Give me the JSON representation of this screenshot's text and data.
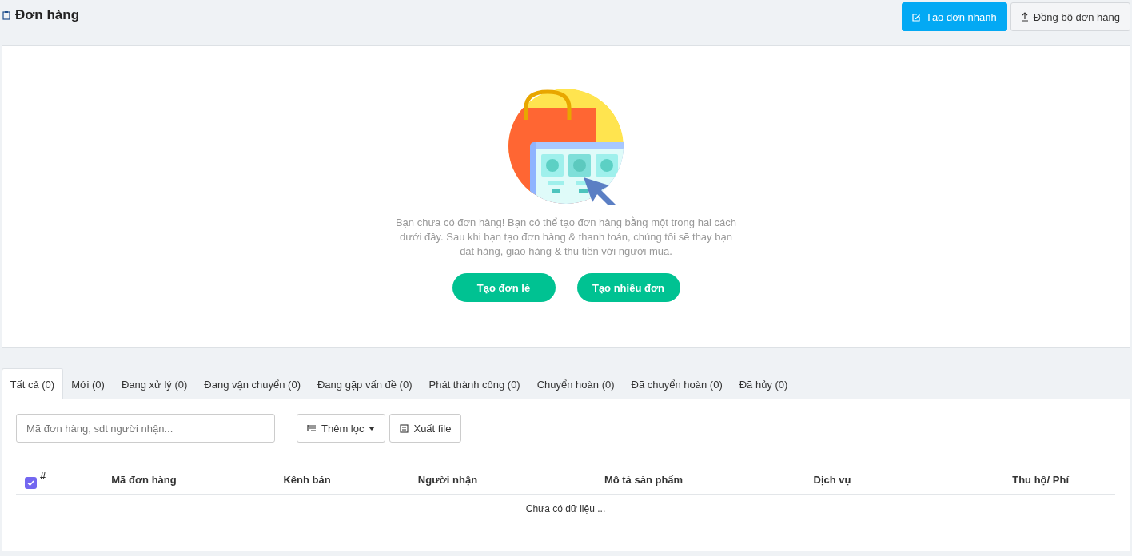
{
  "header": {
    "title": "Đơn hàng",
    "buttons": [
      {
        "label": "Tạo đơn nhanh",
        "kind": "primary"
      },
      {
        "label": "Đồng bộ đơn hàng",
        "kind": "default"
      }
    ]
  },
  "empty_state": {
    "message": "Bạn chưa có đơn hàng! Bạn có thể tạo đơn hàng bằng một trong hai cách dưới đây. Sau khi bạn tạo đơn hàng & thanh toán, chúng tôi sẽ thay bạn đặt hàng, giao hàng & thu tiền với người mua.",
    "buttons": [
      "Tạo đơn lẻ",
      "Tạo nhiều đơn"
    ]
  },
  "tabs": [
    {
      "label": "Tất cả (0)",
      "selected": true
    },
    {
      "label": "Mới (0)",
      "selected": false
    },
    {
      "label": "Đang xử lý (0)",
      "selected": false
    },
    {
      "label": "Đang vận chuyển (0)",
      "selected": false
    },
    {
      "label": "Đang gặp vấn đề (0)",
      "selected": false
    },
    {
      "label": "Phát thành công (0)",
      "selected": false
    },
    {
      "label": "Chuyển hoàn (0)",
      "selected": false
    },
    {
      "label": "Đã chuyển hoàn (0)",
      "selected": false
    },
    {
      "label": "Đã hủy (0)",
      "selected": false
    }
  ],
  "search": {
    "placeholder": "Mã đơn hàng, sdt người nhận..."
  },
  "toolbar": [
    {
      "label": "Thêm lọc",
      "kind": "filter"
    },
    {
      "label": "Xuất file",
      "kind": "export"
    }
  ],
  "table": {
    "select_all_checked": true,
    "columns": [
      "#",
      "Mã đơn hàng",
      "Kênh bán",
      "Người nhận",
      "Mô tả sản phẩm",
      "Dịch vụ",
      "Thu hộ/ Phí"
    ],
    "empty_text": "Chưa có dữ liệu ..."
  }
}
